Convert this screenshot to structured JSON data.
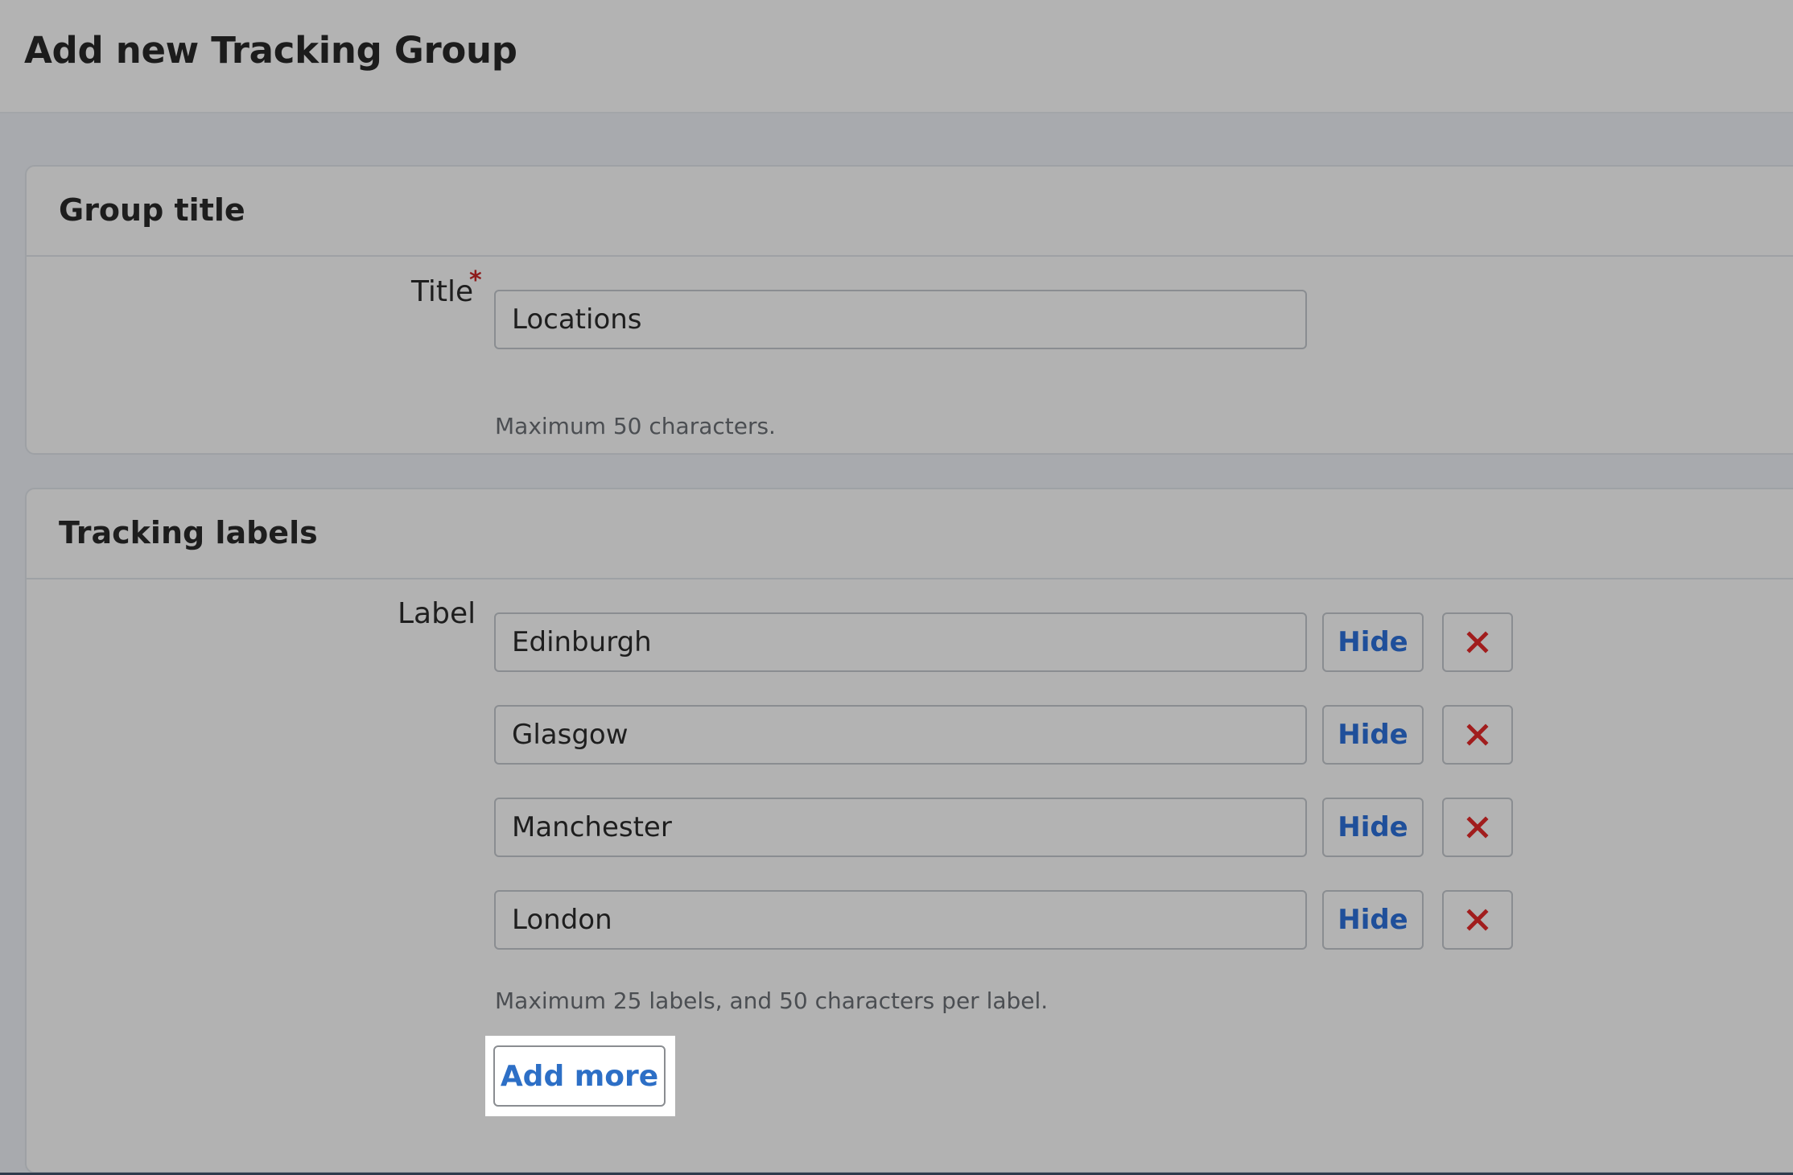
{
  "page": {
    "title": "Add new Tracking Group"
  },
  "group_title_card": {
    "heading": "Group title",
    "field_label": "Title",
    "required_mark": "*",
    "value": "Locations",
    "help": "Maximum 50 characters."
  },
  "tracking_labels_card": {
    "heading": "Tracking labels",
    "field_label": "Label",
    "labels": [
      {
        "value": "Edinburgh",
        "hide_label": "Hide",
        "remove_icon": "close-icon"
      },
      {
        "value": "Glasgow",
        "hide_label": "Hide",
        "remove_icon": "close-icon"
      },
      {
        "value": "Manchester",
        "hide_label": "Hide",
        "remove_icon": "close-icon"
      },
      {
        "value": "London",
        "hide_label": "Hide",
        "remove_icon": "close-icon"
      }
    ],
    "help": "Maximum 25 labels, and 50 characters per label.",
    "add_more_label": "Add more"
  },
  "colors": {
    "link_blue": "#1f4f9a",
    "add_more_blue": "#2d6fc6",
    "remove_red": "#a11d1d",
    "required_red": "#8e1b1b",
    "highlight": "#ffffff"
  }
}
